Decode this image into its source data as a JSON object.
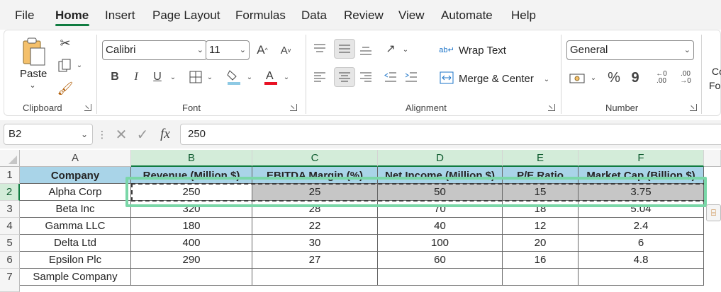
{
  "menu": {
    "items": [
      "File",
      "Home",
      "Insert",
      "Page Layout",
      "Formulas",
      "Data",
      "Review",
      "View",
      "Automate",
      "Help"
    ],
    "active": "Home"
  },
  "ribbon": {
    "clipboard": {
      "paste_label": "Paste",
      "group_label": "Clipboard"
    },
    "font": {
      "font_name": "Calibri",
      "font_size": "11",
      "group_label": "Font",
      "bold": "B",
      "italic": "I",
      "underline": "U"
    },
    "alignment": {
      "wrap_text": "Wrap Text",
      "merge_center": "Merge & Center",
      "group_label": "Alignment"
    },
    "number": {
      "format": "General",
      "group_label": "Number",
      "percent": "%",
      "comma": "9"
    },
    "cut_off": {
      "line1": "Co",
      "line2": "Fo"
    }
  },
  "formula_bar": {
    "name_box": "B2",
    "fx": "fx",
    "value": "250"
  },
  "sheet": {
    "columns": [
      "A",
      "B",
      "C",
      "D",
      "E",
      "F"
    ],
    "rows": [
      "1",
      "2",
      "3",
      "4",
      "5",
      "6",
      "7"
    ],
    "headers": [
      "Company",
      "Revenue (Million $)",
      "EBITDA Margin (%)",
      "Net Income (Million $)",
      "P/E Ratio",
      "Market Cap (Billion $)"
    ],
    "data": [
      [
        "Alpha Corp",
        "250",
        "25",
        "50",
        "15",
        "3.75"
      ],
      [
        "Beta Inc",
        "320",
        "28",
        "70",
        "18",
        "5.04"
      ],
      [
        "Gamma LLC",
        "180",
        "22",
        "40",
        "12",
        "2.4"
      ],
      [
        "Delta Ltd",
        "400",
        "30",
        "100",
        "20",
        "6"
      ],
      [
        "Epsilon Plc",
        "290",
        "27",
        "60",
        "16",
        "4.8"
      ],
      [
        "Sample Company",
        "",
        "",
        "",
        "",
        ""
      ]
    ]
  },
  "colors": {
    "accent": "#107c41",
    "header_fill": "#a9d4e8",
    "selection_fill": "#c6c6c6",
    "highlight_frame": "#7ad7a8"
  }
}
